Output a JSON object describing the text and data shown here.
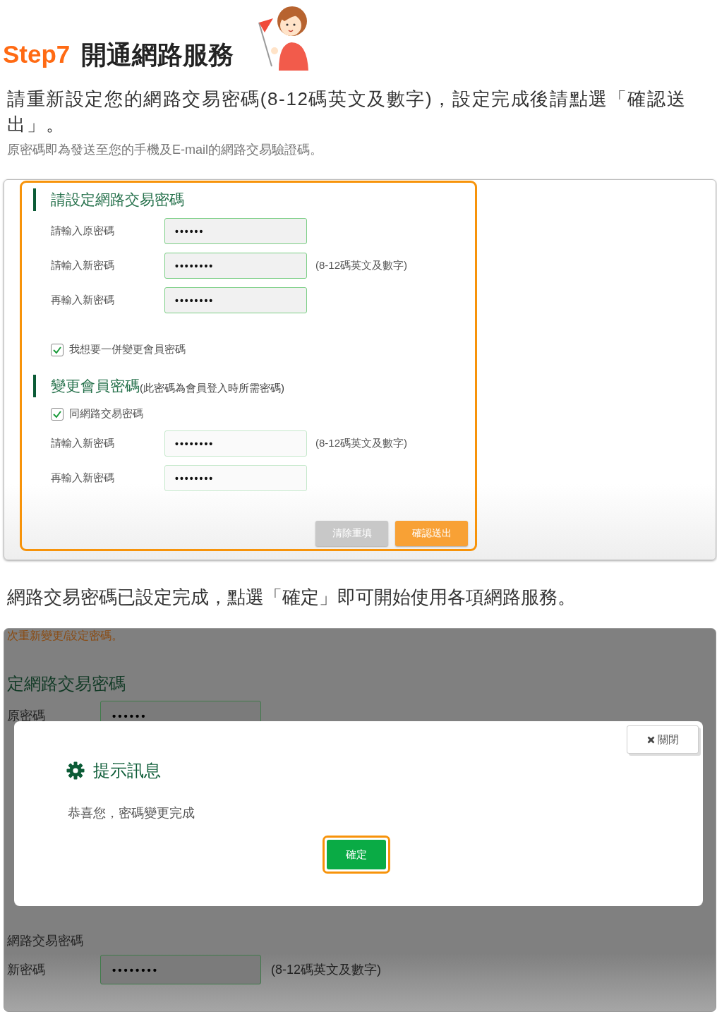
{
  "header": {
    "step": "Step7",
    "title": "開通網路服務"
  },
  "intro": "請重新設定您的網路交易密碼(8-12碼英文及數字)，設定完成後請點選「確認送出」。",
  "note": "原密碼即為發送至您的手機及E-mail的網路交易驗證碼。",
  "form": {
    "sections": [
      {
        "title": "請設定網路交易密碼",
        "fields": [
          {
            "label": "請輸入原密碼",
            "value": "••••••",
            "disabled": false
          },
          {
            "label": "請輸入新密碼",
            "value": "••••••••",
            "hint": "(8-12碼英文及數字)",
            "disabled": false
          },
          {
            "label": "再輸入新密碼",
            "value": "••••••••",
            "disabled": false
          }
        ],
        "checkbox": {
          "label": "我想要一併變更會員密碼",
          "checked": true
        }
      },
      {
        "title": "變更會員密碼",
        "subtitle": "(此密碼為會員登入時所需密碼)",
        "checkbox": {
          "label": "同網路交易密碼",
          "checked": true
        },
        "fields": [
          {
            "label": "請輸入新密碼",
            "value": "••••••••",
            "hint": "(8-12碼英文及數字)",
            "disabled": true
          },
          {
            "label": "再輸入新密碼",
            "value": "••••••••",
            "disabled": true
          }
        ]
      }
    ],
    "buttons": [
      {
        "label": "清除重填",
        "kind": "reset"
      },
      {
        "label": "確認送出",
        "kind": "submit"
      }
    ]
  },
  "completion_text": "網路交易密碼已設定完成，點選「確定」即可開始使用各項網路服務。",
  "screenshot": {
    "background": [
      {
        "kind": "notice",
        "text": "次重新變更/設定密碼。"
      },
      {
        "kind": "heading",
        "text": "定網路交易密碼"
      },
      {
        "kind": "field",
        "label": "原密碼",
        "value": "••••••"
      },
      {
        "kind": "text",
        "text": "網路交易密碼"
      },
      {
        "kind": "field",
        "label": "新密碼",
        "value": "••••••••",
        "hint": "(8-12碼英文及數字)"
      }
    ],
    "dialog": {
      "close_label": "關閉",
      "title": "提示訊息",
      "message": "恭喜您，密碼變更完成",
      "button": {
        "label": "確定",
        "focused": true
      }
    }
  }
}
